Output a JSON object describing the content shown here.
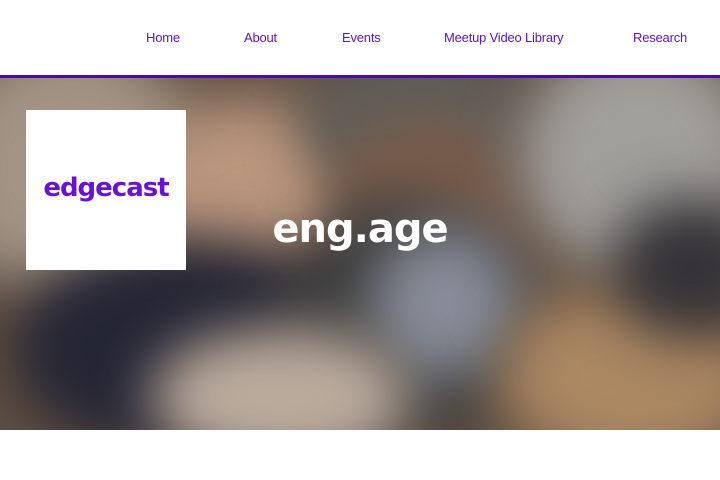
{
  "nav": {
    "items": [
      {
        "label": "Home"
      },
      {
        "label": "About"
      },
      {
        "label": "Events"
      },
      {
        "label": "Meetup Video Library"
      },
      {
        "label": "Research"
      }
    ]
  },
  "hero": {
    "logo_text": "edgecast",
    "title": "eng.age"
  },
  "colors": {
    "accent": "#5a14c8",
    "nav_rule": "#4c0b9e",
    "logo": "#6a10d8",
    "hero_title": "#ffffff"
  }
}
